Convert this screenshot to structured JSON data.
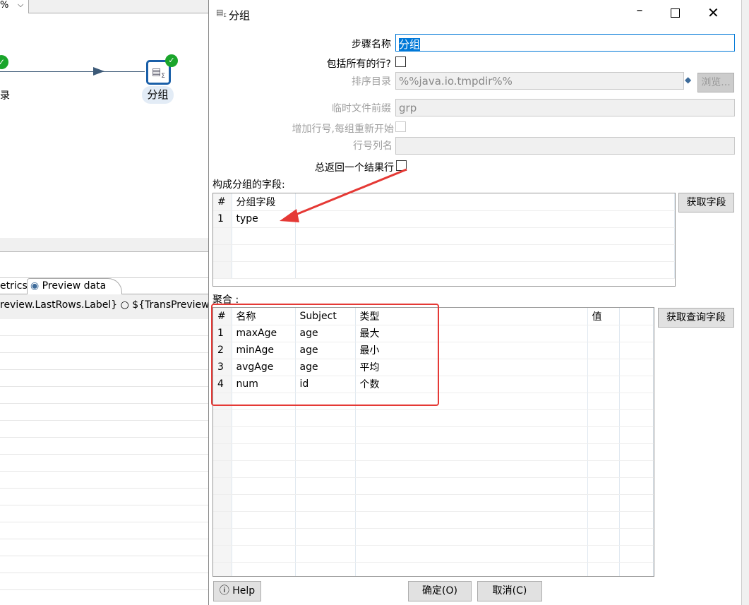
{
  "background": {
    "zoom_value": "%",
    "canvas": {
      "prev_step_label": "录",
      "step_label": "分组"
    },
    "tabs": [
      {
        "label": "etrics"
      },
      {
        "label": "Preview data",
        "icon": "eye-icon"
      }
    ],
    "toolbar_text": "review.LastRows.Label}",
    "toolbar_radio_label": "${TransPreview"
  },
  "dialog": {
    "title": "分组",
    "icon": "group-by-icon",
    "fields": {
      "step_name_label": "步骤名称",
      "step_name_value": "分组",
      "include_all_rows_label": "包括所有的行?",
      "sort_dir_label": "排序目录",
      "sort_dir_value": "%%java.io.tmpdir%%",
      "browse_label": "浏览...",
      "tmp_prefix_label": "临时文件前缀",
      "tmp_prefix_value": "grp",
      "add_line_nr_label": "增加行号,每组重新开始",
      "line_nr_field_label": "行号列名",
      "line_nr_field_value": "",
      "always_result_label": "总返回一个结果行"
    },
    "group_section": {
      "label": "构成分组的字段:",
      "columns": [
        "#",
        "分组字段"
      ],
      "rows": [
        [
          "1",
          "type"
        ]
      ],
      "get_fields_label": "获取字段"
    },
    "agg_section": {
      "label": "聚合 :",
      "columns": [
        "#",
        "名称",
        "Subject",
        "类型",
        "值"
      ],
      "rows": [
        [
          "1",
          "maxAge",
          "age",
          "最大",
          ""
        ],
        [
          "2",
          "minAge",
          "age",
          "最小",
          ""
        ],
        [
          "3",
          "avgAge",
          "age",
          "平均",
          ""
        ],
        [
          "4",
          "num",
          "id",
          "个数",
          ""
        ]
      ],
      "get_lookup_label": "获取查询字段"
    },
    "buttons": {
      "help": "Help",
      "ok": "确定(O)",
      "cancel": "取消(C)"
    },
    "annotation_color": "#e53935",
    "selection_color": "#0078d7"
  }
}
